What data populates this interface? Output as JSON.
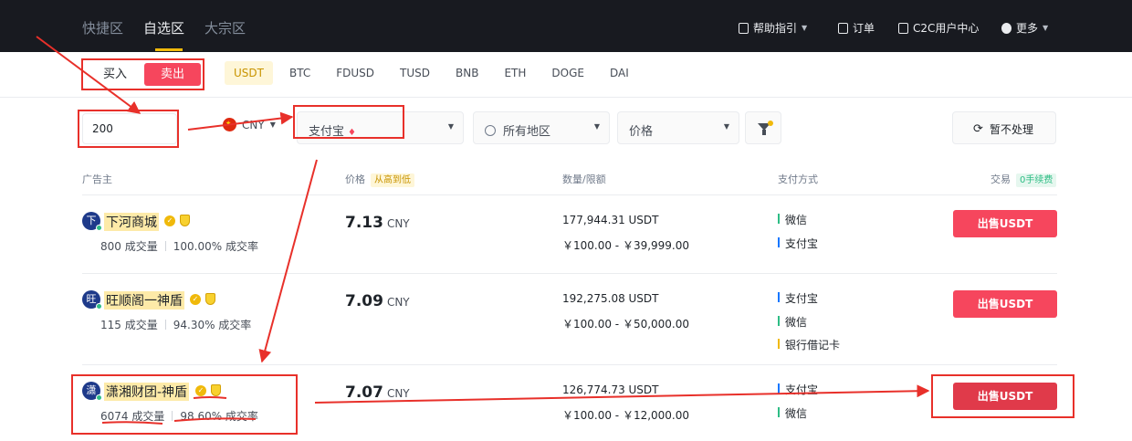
{
  "nav": {
    "tabs": [
      "快捷区",
      "自选区",
      "大宗区"
    ],
    "active_tab": "自选区",
    "right": {
      "help": "帮助指引",
      "orders": "订单",
      "c2c": "C2C用户中心",
      "more": "更多"
    }
  },
  "trade": {
    "buy_label": "买入",
    "sell_label": "卖出",
    "active": "卖出"
  },
  "coins": [
    "USDT",
    "BTC",
    "FDUSD",
    "TUSD",
    "BNB",
    "ETH",
    "DOGE",
    "DAI"
  ],
  "active_coin": "USDT",
  "filters": {
    "amount": "200",
    "currency": "CNY",
    "payment": "支付宝",
    "region": "所有地区",
    "sort": "价格",
    "refresh": "暂不处理"
  },
  "headers": {
    "advertiser": "广告主",
    "price": "价格",
    "price_sort": "从高到低",
    "amount_limit": "数量/限额",
    "payment": "支付方式",
    "trade": "交易",
    "fee": "0手续费"
  },
  "rows": [
    {
      "avatar": "下",
      "name": "下河商城",
      "orders": "800 成交量",
      "rate": "100.00% 成交率",
      "price": "7.13",
      "currency": "CNY",
      "available": "177,944.31 USDT",
      "limit": "￥100.00 - ￥39,999.00",
      "payments": [
        "微信",
        "支付宝"
      ],
      "action": "出售USDT"
    },
    {
      "avatar": "旺",
      "name": "旺顺阁一神盾",
      "orders": "115 成交量",
      "rate": "94.30% 成交率",
      "price": "7.09",
      "currency": "CNY",
      "available": "192,275.08 USDT",
      "limit": "￥100.00 - ￥50,000.00",
      "payments": [
        "支付宝",
        "微信",
        "银行借记卡"
      ],
      "action": "出售USDT"
    },
    {
      "avatar": "潇",
      "name": "潇湘财团-神盾",
      "orders": "6074 成交量",
      "rate": "98.60% 成交率",
      "price": "7.07",
      "currency": "CNY",
      "available": "126,774.73 USDT",
      "limit": "￥100.00 - ￥12,000.00",
      "payments": [
        "支付宝",
        "微信"
      ],
      "action": "出售USDT"
    }
  ],
  "colors": {
    "accent": "#f0b90b",
    "sell": "#f6465d",
    "annotation": "#e8302a"
  }
}
